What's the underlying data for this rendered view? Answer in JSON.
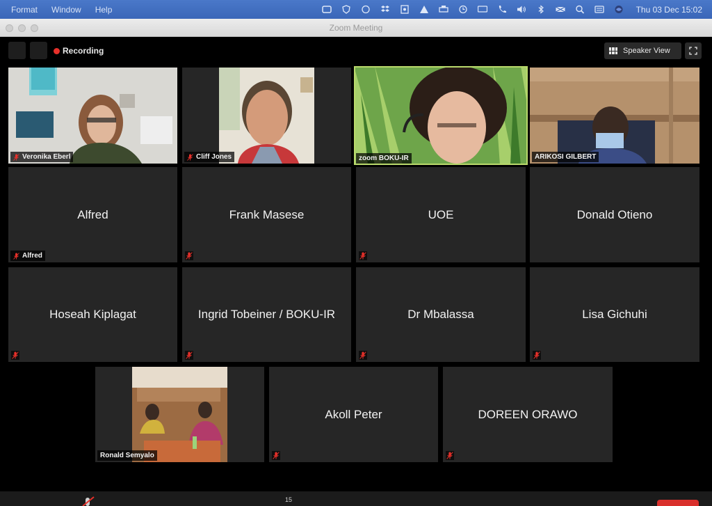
{
  "menubar": {
    "menus": [
      "Format",
      "Window",
      "Help"
    ],
    "clock": "Thu 03 Dec  15:02",
    "icons": [
      "window-icon",
      "shield-icon",
      "circle-icon",
      "dropbox-icon",
      "screenshot-icon",
      "alert-icon",
      "print-icon",
      "clock-icon",
      "display-icon",
      "phone-icon",
      "volume-icon",
      "bluetooth-icon",
      "keyboard-flag-icon",
      "search-icon",
      "control-center-icon",
      "siri-icon"
    ]
  },
  "window": {
    "title": "Zoom Meeting"
  },
  "toolbar": {
    "recording_label": "Recording",
    "speaker_view_label": "Speaker View"
  },
  "accent": {
    "active_speaker": "#b9d96b",
    "recording": "#e8302a",
    "muted": "#e8302a"
  },
  "participants_video": [
    {
      "name": "Veronika Eberl",
      "muted": true
    },
    {
      "name": "Cliff Jones",
      "muted": true
    },
    {
      "name": "zoom BOKU-IR",
      "muted": false,
      "active": true
    },
    {
      "name": "ARIKOSI GILBERT",
      "muted": false
    }
  ],
  "participants_row2": [
    {
      "name": "Alfred",
      "tag": "Alfred",
      "muted": true
    },
    {
      "name": "Frank Masese",
      "muted": true
    },
    {
      "name": "UOE",
      "muted": true
    },
    {
      "name": "Donald Otieno",
      "muted": false
    }
  ],
  "participants_row3": [
    {
      "name": "Hoseah Kiplagat",
      "muted": true
    },
    {
      "name": "Ingrid Tobeiner / BOKU-IR",
      "muted": true
    },
    {
      "name": "Dr Mbalassa",
      "muted": true
    },
    {
      "name": "Lisa Gichuhi",
      "muted": true
    }
  ],
  "participants_row4": [
    {
      "name": "Ronald Semyalo",
      "muted": false
    },
    {
      "name": "Akoll Peter",
      "muted": true
    },
    {
      "name": "DOREEN ORAWO",
      "muted": true
    }
  ],
  "bottombar": {
    "participant_count": "15"
  }
}
